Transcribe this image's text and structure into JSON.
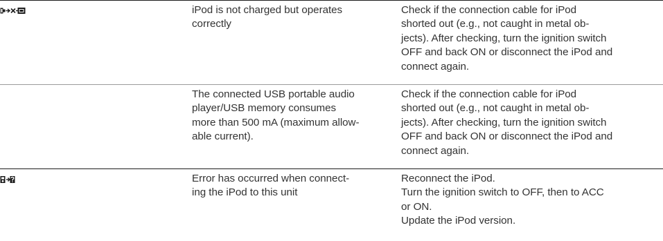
{
  "rows": [
    {
      "icon": "ipod-battery-error-icon",
      "symptom_lines": [
        "iPod is not charged but operates",
        "correctly"
      ],
      "action_lines": [
        "Check if the connection cable for iPod",
        "shorted out (e.g., not caught in metal ob-",
        "jects). After checking, turn the ignition switch",
        "OFF and back ON or disconnect the iPod and",
        "connect again."
      ]
    },
    {
      "symptom_lines": [
        "The connected USB portable audio",
        "player/USB memory consumes",
        "more than 500 mA (maximum allow-",
        "able current)."
      ],
      "action_lines": [
        "Check if the connection cable for iPod",
        "shorted out (e.g., not caught in metal ob-",
        "jects). After checking, turn the ignition switch",
        "OFF and back ON or disconnect the iPod and",
        "connect again."
      ]
    },
    {
      "icon": "ipod-connection-error-icon",
      "symptom_lines": [
        "Error has occurred when connect-",
        "ing the iPod to this unit"
      ],
      "action_lines": [
        "Reconnect the iPod.",
        "Turn the ignition switch to OFF, then to ACC",
        "or ON.",
        "Update the iPod version."
      ]
    }
  ]
}
